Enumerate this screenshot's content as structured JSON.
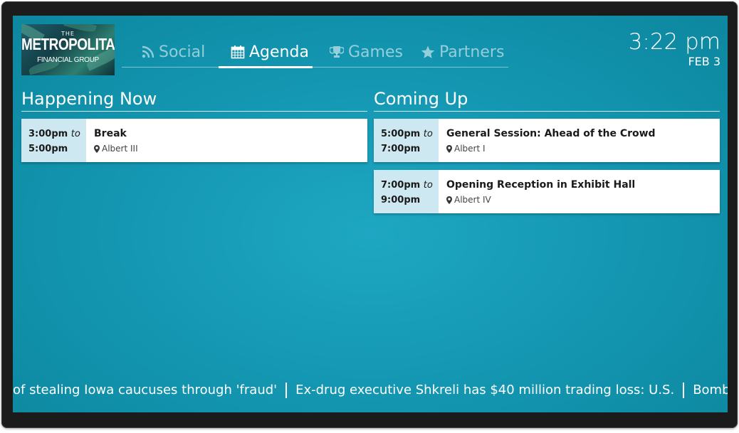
{
  "logo": {
    "line1": "THE",
    "line2": "METROPOLITAN",
    "line3": "FINANCIAL GROUP"
  },
  "nav": {
    "tabs": [
      {
        "label": "Social",
        "icon": "rss-icon",
        "active": false
      },
      {
        "label": "Agenda",
        "icon": "calendar-icon",
        "active": true
      },
      {
        "label": "Games",
        "icon": "trophy-icon",
        "active": false
      },
      {
        "label": "Partners",
        "icon": "star-icon",
        "active": false
      }
    ]
  },
  "clock": {
    "time": "3:22 pm",
    "date": "FEB 3"
  },
  "happening_now": {
    "title": "Happening Now",
    "items": [
      {
        "start": "3:00pm",
        "to": "to",
        "end": "5:00pm",
        "title": "Break",
        "location": "Albert III"
      }
    ]
  },
  "coming_up": {
    "title": "Coming Up",
    "items": [
      {
        "start": "5:00pm",
        "to": "to",
        "end": "7:00pm",
        "title": "General Session: Ahead of the Crowd",
        "location": "Albert I"
      },
      {
        "start": "7:00pm",
        "to": "to",
        "end": "9:00pm",
        "title": "Opening Reception in Exhibit Hall",
        "location": "Albert IV"
      }
    ]
  },
  "ticker": {
    "items": [
      "of stealing Iowa caucuses through 'fraud'",
      "Ex-drug executive Shkreli has $40 million trading loss: U.S.",
      "Bomb likely caused S"
    ]
  },
  "colors": {
    "screen": "#1395b0",
    "time_box": "#cde8f1",
    "bezel": "#1b1b1b"
  }
}
